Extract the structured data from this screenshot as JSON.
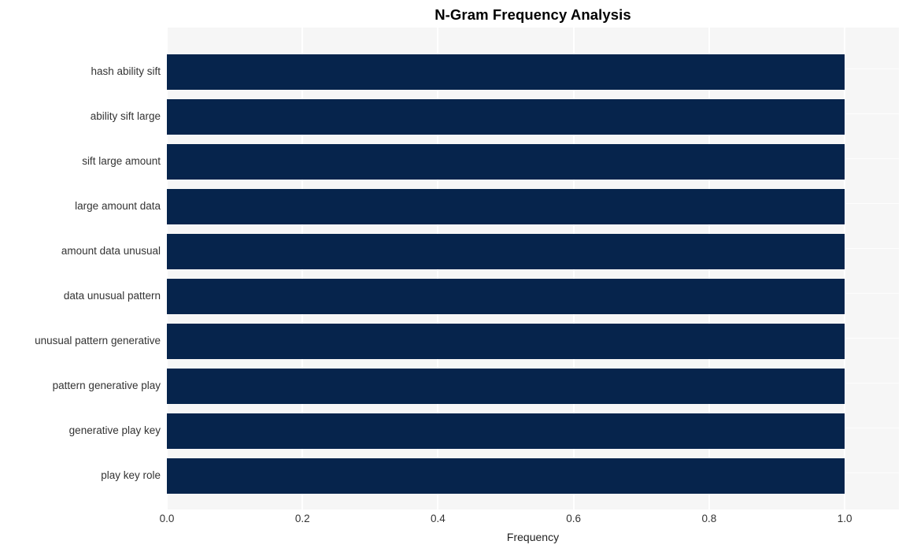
{
  "chart_data": {
    "type": "bar",
    "orientation": "horizontal",
    "title": "N-Gram Frequency Analysis",
    "xlabel": "Frequency",
    "ylabel": "",
    "categories": [
      "hash ability sift",
      "ability sift large",
      "sift large amount",
      "large amount data",
      "amount data unusual",
      "data unusual pattern",
      "unusual pattern generative",
      "pattern generative play",
      "generative play key",
      "play key role"
    ],
    "values": [
      1.0,
      1.0,
      1.0,
      1.0,
      1.0,
      1.0,
      1.0,
      1.0,
      1.0,
      1.0
    ],
    "xticks": [
      "0.0",
      "0.2",
      "0.4",
      "0.6",
      "0.8",
      "1.0"
    ],
    "xtick_values": [
      0.0,
      0.2,
      0.4,
      0.6,
      0.8,
      1.0
    ],
    "xlim": [
      0.0,
      1.08
    ],
    "grid": true,
    "legend": null,
    "bar_color": "#06244c",
    "plot_background": "#f6f6f6",
    "gridline_color": "#ffffff",
    "text_color": "#333333",
    "title_color": "#000000"
  }
}
